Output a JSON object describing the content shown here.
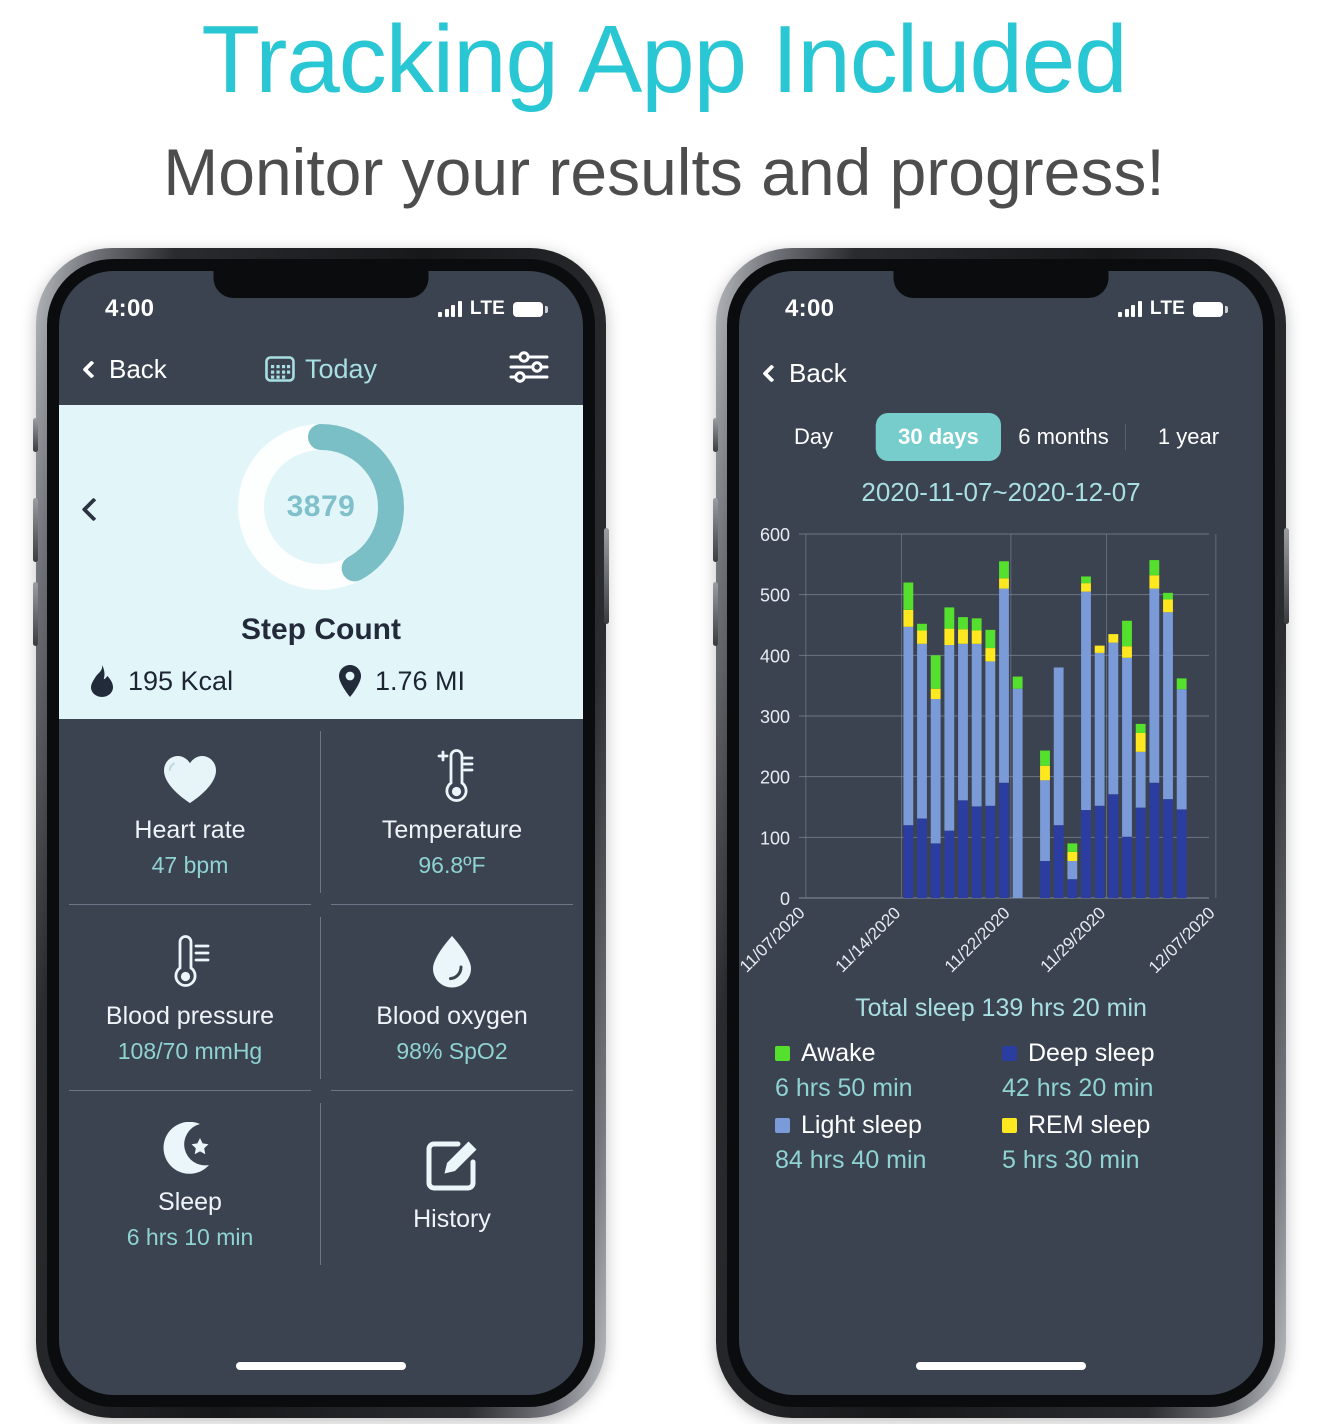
{
  "headline": "Tracking App Included",
  "subhead": "Monitor your results and progress!",
  "colors": {
    "accent_teal": "#29c6d3",
    "screen_bg": "#3b4250",
    "card_bg": "#e2f6fa",
    "ring_fill": "#7bbfc6",
    "value_text": "#8fd3d3",
    "awake": "#56e02e",
    "rem": "#ffe81f",
    "light_sleep": "#7b9ad8",
    "deep_sleep": "#2b3da0"
  },
  "left_phone": {
    "status": {
      "time": "4:00",
      "network": "LTE"
    },
    "nav": {
      "back": "Back",
      "title": "Today",
      "calendar_icon": "calendar-icon",
      "settings_icon": "sliders-icon"
    },
    "step_card": {
      "value": "3879",
      "label": "Step Count",
      "progress_pct": 42,
      "calories": "195 Kcal",
      "calories_icon": "flame-icon",
      "distance": "1.76 MI",
      "distance_icon": "location-pin-icon"
    },
    "metrics": [
      {
        "icon": "heart-icon",
        "name": "Heart rate",
        "value": "47 bpm"
      },
      {
        "icon": "thermometer-plus-icon",
        "name": "Temperature",
        "value": "96.8ºF"
      },
      {
        "icon": "thermometer-icon",
        "name": "Blood pressure",
        "value": "108/70 mmHg"
      },
      {
        "icon": "water-drop-icon",
        "name": "Blood oxygen",
        "value": "98% SpO2"
      },
      {
        "icon": "moon-star-icon",
        "name": "Sleep",
        "value": "6 hrs 10 min"
      },
      {
        "icon": "edit-square-icon",
        "name": "History",
        "value": ""
      }
    ]
  },
  "right_phone": {
    "status": {
      "time": "4:00",
      "network": "LTE"
    },
    "nav": {
      "back": "Back"
    },
    "segments": [
      {
        "label": "Day",
        "active": false
      },
      {
        "label": "30 days",
        "active": true
      },
      {
        "label": "6 months",
        "active": false
      },
      {
        "label": "1 year",
        "active": false
      }
    ],
    "date_range": "2020-11-07~2020-12-07",
    "total_sleep": "Total sleep 139 hrs 20 min",
    "legend": [
      {
        "name": "Awake",
        "value": "6 hrs 50 min",
        "color": "#56e02e"
      },
      {
        "name": "Deep sleep",
        "value": "42 hrs 20 min",
        "color": "#2b3da0"
      },
      {
        "name": "Light sleep",
        "value": "84 hrs 40 min",
        "color": "#7b9ad8"
      },
      {
        "name": "REM sleep",
        "value": "5 hrs 30 min",
        "color": "#ffe81f"
      }
    ]
  },
  "chart_data": {
    "type": "bar",
    "title": "",
    "stacked": true,
    "xlabel": "",
    "ylabel": "",
    "ylim": [
      0,
      600
    ],
    "yticks": [
      0,
      100,
      200,
      300,
      400,
      500,
      600
    ],
    "grid": true,
    "legend_position": "below",
    "xtick_labels": [
      "11/07/2020",
      "11/14/2020",
      "11/22/2020",
      "11/29/2020",
      "12/07/2020"
    ],
    "xtick_positions": [
      0,
      7,
      15,
      22,
      30
    ],
    "series_order": [
      "Deep sleep",
      "Light sleep",
      "REM sleep",
      "Awake"
    ],
    "series_colors": {
      "Deep sleep": "#2b3da0",
      "Light sleep": "#7b9ad8",
      "REM sleep": "#ffe81f",
      "Awake": "#56e02e"
    },
    "bars": [
      {
        "day": 0,
        "deep": 0,
        "light": 0,
        "rem": 0,
        "awake": 0
      },
      {
        "day": 1,
        "deep": 0,
        "light": 0,
        "rem": 0,
        "awake": 0
      },
      {
        "day": 2,
        "deep": 0,
        "light": 0,
        "rem": 0,
        "awake": 0
      },
      {
        "day": 3,
        "deep": 0,
        "light": 0,
        "rem": 0,
        "awake": 0
      },
      {
        "day": 4,
        "deep": 0,
        "light": 0,
        "rem": 0,
        "awake": 0
      },
      {
        "day": 5,
        "deep": 0,
        "light": 0,
        "rem": 0,
        "awake": 0
      },
      {
        "day": 6,
        "deep": 0,
        "light": 0,
        "rem": 0,
        "awake": 0
      },
      {
        "day": 7,
        "deep": 120,
        "light": 327,
        "rem": 28,
        "awake": 45
      },
      {
        "day": 8,
        "deep": 131,
        "light": 288,
        "rem": 22,
        "awake": 11
      },
      {
        "day": 9,
        "deep": 90,
        "light": 238,
        "rem": 17,
        "awake": 55
      },
      {
        "day": 10,
        "deep": 111,
        "light": 306,
        "rem": 27,
        "awake": 35
      },
      {
        "day": 11,
        "deep": 161,
        "light": 258,
        "rem": 24,
        "awake": 20
      },
      {
        "day": 12,
        "deep": 151,
        "light": 268,
        "rem": 22,
        "awake": 20
      },
      {
        "day": 13,
        "deep": 152,
        "light": 238,
        "rem": 22,
        "awake": 30
      },
      {
        "day": 14,
        "deep": 190,
        "light": 320,
        "rem": 17,
        "awake": 28
      },
      {
        "day": 15,
        "deep": 0,
        "light": 345,
        "rem": 0,
        "awake": 20
      },
      {
        "day": 16,
        "deep": 0,
        "light": 0,
        "rem": 0,
        "awake": 0
      },
      {
        "day": 17,
        "deep": 61,
        "light": 133,
        "rem": 24,
        "awake": 25
      },
      {
        "day": 18,
        "deep": 120,
        "light": 260,
        "rem": 0,
        "awake": 0
      },
      {
        "day": 19,
        "deep": 31,
        "light": 30,
        "rem": 15,
        "awake": 14
      },
      {
        "day": 20,
        "deep": 145,
        "light": 360,
        "rem": 14,
        "awake": 11
      },
      {
        "day": 21,
        "deep": 152,
        "light": 252,
        "rem": 12,
        "awake": 0
      },
      {
        "day": 22,
        "deep": 171,
        "light": 250,
        "rem": 14,
        "awake": 0
      },
      {
        "day": 23,
        "deep": 101,
        "light": 295,
        "rem": 19,
        "awake": 42
      },
      {
        "day": 24,
        "deep": 149,
        "light": 92,
        "rem": 31,
        "awake": 15
      },
      {
        "day": 25,
        "deep": 190,
        "light": 320,
        "rem": 22,
        "awake": 25
      },
      {
        "day": 26,
        "deep": 163,
        "light": 308,
        "rem": 21,
        "awake": 11
      },
      {
        "day": 27,
        "deep": 146,
        "light": 198,
        "rem": 0,
        "awake": 18
      }
    ]
  }
}
